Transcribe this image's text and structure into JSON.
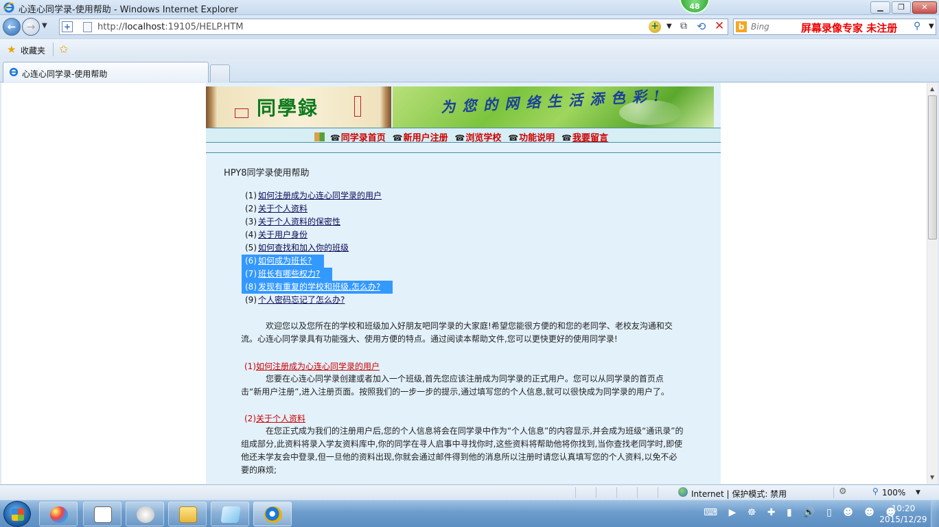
{
  "window": {
    "title": "心连心同学录-使用帮助 - Windows Internet Explorer",
    "badge_count": "48",
    "min_glyph": "▁",
    "max_glyph": "❐",
    "close_glyph": "✕"
  },
  "navbar": {
    "back_glyph": "←",
    "forward_glyph": "→",
    "history_glyph": "▼",
    "url_prefix": "http://",
    "url_host": "localhost",
    "url_rest": ":19105/HELP.HTM",
    "dropdown_glyph": "▼",
    "compat_glyph": "⧉",
    "refresh_glyph": "⟲",
    "stop_glyph": "✕",
    "search_placeholder": "Bing",
    "search_logo": "b",
    "watermark": "屏幕录像专家  未注册",
    "search_glyph": "⚲",
    "search_dd_glyph": "▼"
  },
  "favorites": {
    "label": "收藏夹",
    "star_glyph": "★",
    "add_glyph": "✩"
  },
  "tabs": [
    {
      "label": "心连心同学录-使用帮助"
    }
  ],
  "page": {
    "banner": {
      "logo_text": "同學録",
      "slogan": "为您的网络生活添色彩!"
    },
    "menu": [
      {
        "label": "同学录首页",
        "underline": false
      },
      {
        "label": "新用户注册",
        "underline": false
      },
      {
        "label": "浏览学校",
        "underline": false
      },
      {
        "label": "功能说明",
        "underline": false
      },
      {
        "label": "我要留言",
        "underline": true
      }
    ],
    "menu_icon": "☎",
    "help_title": "HPY8同学录使用帮助",
    "toc": [
      {
        "num": "(1)",
        "label": "如何注册成为心连心同学录的用户",
        "selected": false
      },
      {
        "num": "(2)",
        "label": "关于个人资料",
        "selected": false
      },
      {
        "num": "(3)",
        "label": "关于个人资料的保密性",
        "selected": false
      },
      {
        "num": "(4)",
        "label": "关于用户身份",
        "selected": false
      },
      {
        "num": "(5)",
        "label": "如何查找和加入你的班级",
        "selected": false
      },
      {
        "num": "(6)",
        "label": "如何成为班长?",
        "selected": true
      },
      {
        "num": "(7)",
        "label": "班长有哪些权力?",
        "selected": true
      },
      {
        "num": "(8)",
        "label": "发现有重复的学校和班级,怎么办?",
        "selected": true
      },
      {
        "num": "(9)",
        "label": "个人密码忘记了怎么办?",
        "selected": false
      }
    ],
    "intro": "　　　欢迎您以及您所在的学校和班级加入好朋友吧同学录的大家庭!希望您能很方便的和您的老同学、老校友沟通和交流。心连心同学录具有功能强大、使用方便的特点。通过阅读本帮助文件,您可以更快更好的使用同学录!",
    "sections": [
      {
        "num": "(1)",
        "title": "如何注册成为心连心同学录的用户",
        "body": "　　　您要在心连心同学录创建或者加入一个班级,首先您应该注册成为同学录的正式用户。您可以从同学录的首页点击“新用户注册”,进入注册页面。按照我们的一步一步的提示,通过填写您的个人信息,就可以很快成为同学录的用户了。"
      },
      {
        "num": "(2)",
        "title": "关于个人资料",
        "body": "　　　在您正式成为我们的注册用户后,您的个人信息将会在同学录中作为“个人信息”的内容显示,并会成为班级“通讯录”的组成部分,此资料将录入学友资料库中,你的同学在寻人启事中寻找你时,这些资料将帮助他将你找到,当你查找老同学时,即使他还未学友会中登录,但一旦他的资料出现,你就会通过邮件得到他的消息所以注册时请您认真填写您的个人资料,以免不必要的麻烦;"
      }
    ]
  },
  "statusbar": {
    "zone": "Internet | 保护模式: 禁用",
    "zoom": "100%",
    "security_glyph": "⚙",
    "zoom_glyph": "⚲",
    "dd_glyph": "▼"
  },
  "taskbar": {
    "tray_glyphs": "⌨ ▶ ☸ ✚ ▮ 🔊 ▯ ☻ ☻ ☻",
    "time": "10:20",
    "date": "2015/12/29"
  }
}
